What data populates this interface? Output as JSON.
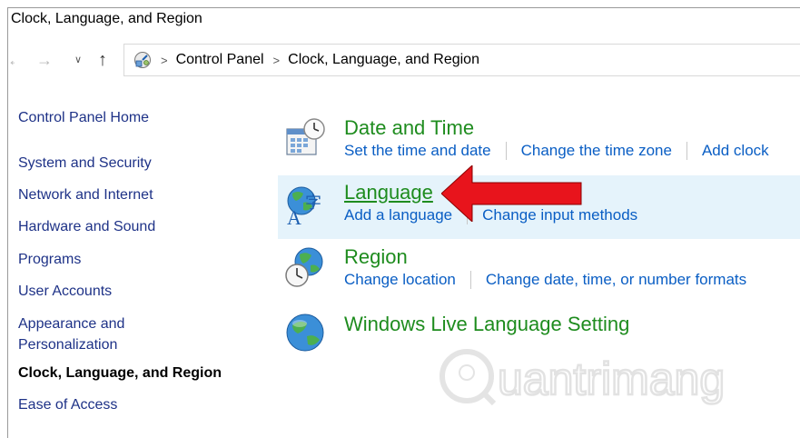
{
  "window": {
    "title": "Clock, Language, and Region"
  },
  "address": {
    "icons": {
      "back": "arrow-left-icon",
      "forward": "arrow-right-icon",
      "recent": "chevron-down-icon",
      "up": "arrow-up-icon"
    },
    "crumbs": [
      "Control Panel",
      "Clock, Language, and Region"
    ]
  },
  "sidebar": {
    "items": [
      {
        "label": "Control Panel Home"
      },
      {
        "label": "System and Security"
      },
      {
        "label": "Network and Internet"
      },
      {
        "label": "Hardware and Sound"
      },
      {
        "label": "Programs"
      },
      {
        "label": "User Accounts"
      },
      {
        "label": "Appearance and"
      },
      {
        "label": "Personalization"
      },
      {
        "label": "Clock, Language, and Region"
      },
      {
        "label": "Ease of Access"
      }
    ]
  },
  "categories": [
    {
      "title": "Date and Time",
      "icon": "calendar-clock-icon",
      "links": [
        "Set the time and date",
        "Change the time zone",
        "Add clock"
      ]
    },
    {
      "title": "Language",
      "icon": "globe-language-icon",
      "links": [
        "Add a language",
        "Change input methods"
      ]
    },
    {
      "title": "Region",
      "icon": "globe-clock-icon",
      "links": [
        "Change location",
        "Change date, time, or number formats"
      ]
    },
    {
      "title": "Windows Live Language Setting",
      "icon": "globe-icon",
      "links": []
    }
  ],
  "colors": {
    "title_green": "#1e8c1e",
    "link_blue": "#0a5ec4",
    "highlight": "#e5f3fb",
    "arrow_red": "#e8141c"
  },
  "watermark": {
    "text": "uantrimang"
  }
}
